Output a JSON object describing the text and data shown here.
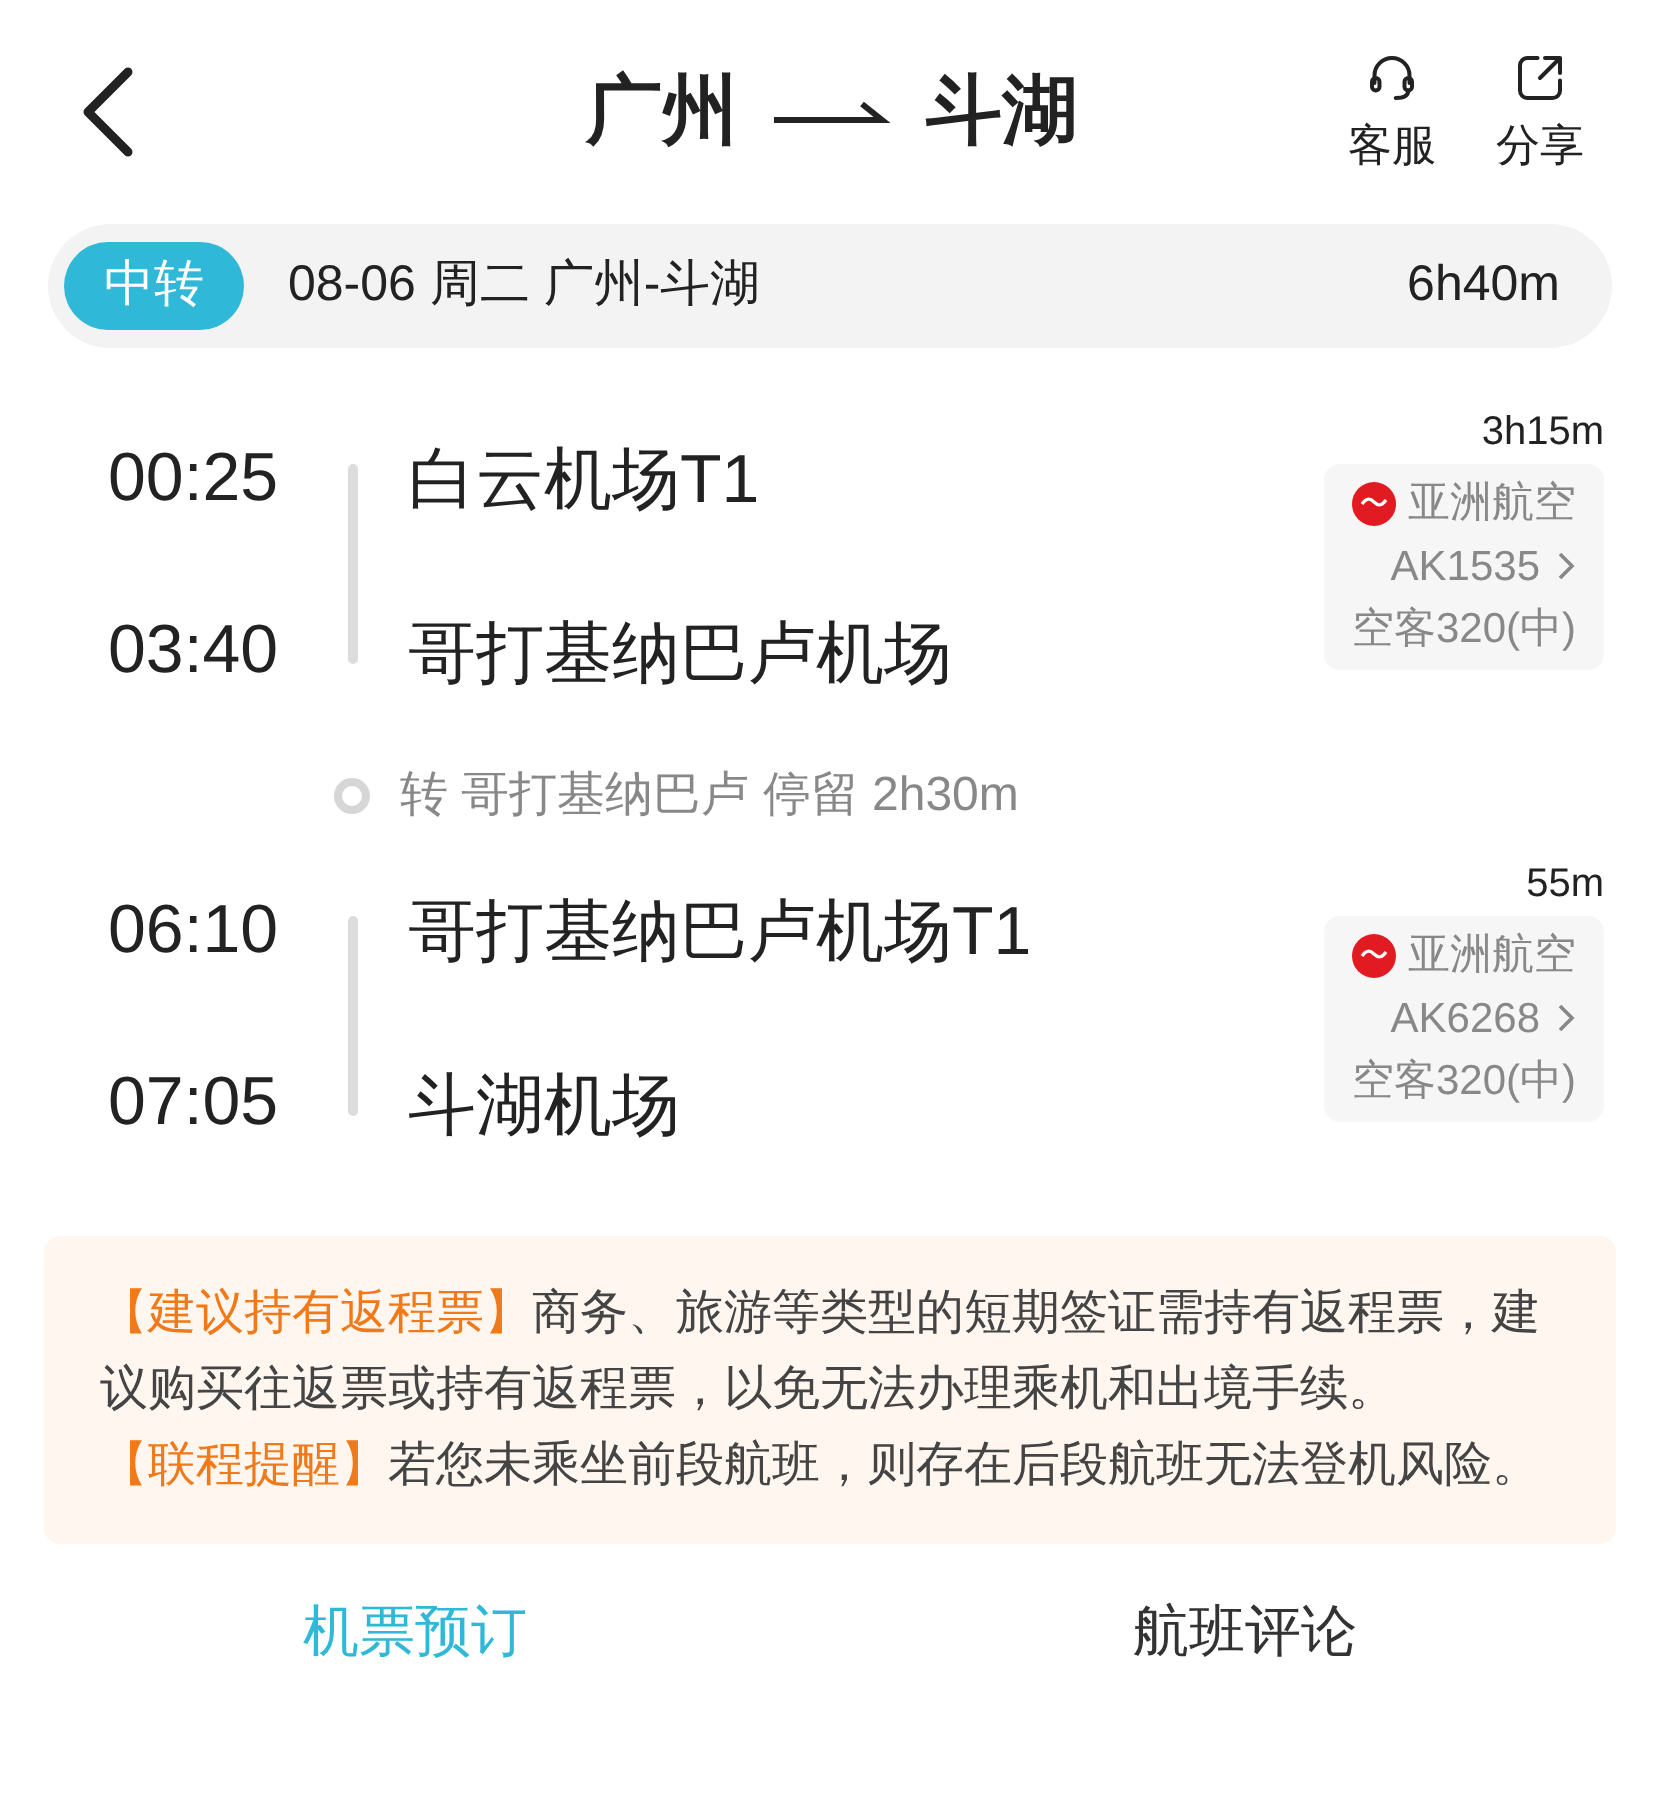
{
  "header": {
    "from": "广州",
    "to": "斗湖",
    "actions": [
      {
        "kind": "service",
        "label": "客服"
      },
      {
        "kind": "share",
        "label": "分享"
      }
    ]
  },
  "summary": {
    "badge": "中转",
    "text": "08-06 周二 广州-斗湖",
    "duration": "6h40m"
  },
  "segments": [
    {
      "dep_time": "00:25",
      "dep_airport": "白云机场T1",
      "arr_time": "03:40",
      "arr_airport": "哥打基纳巴卢机场",
      "duration": "3h15m",
      "airline": "亚洲航空",
      "flight": "AK1535",
      "aircraft": "空客320(中)"
    },
    {
      "dep_time": "06:10",
      "dep_airport": "哥打基纳巴卢机场T1",
      "arr_time": "07:05",
      "arr_airport": "斗湖机场",
      "duration": "55m",
      "airline": "亚洲航空",
      "flight": "AK6268",
      "aircraft": "空客320(中)"
    }
  ],
  "layover": "转 哥打基纳巴卢 停留 2h30m",
  "notices": [
    {
      "tag": "【建议持有返程票】",
      "text": "商务、旅游等类型的短期签证需持有返程票，建议购买往返票或持有返程票，以免无法办理乘机和出境手续。"
    },
    {
      "tag": "【联程提醒】",
      "text": "若您未乘坐前段航班，则存在后段航班无法登机风险。"
    }
  ],
  "tabs": [
    {
      "label": "机票预订",
      "selected": true
    },
    {
      "label": "航班评论",
      "selected": false
    }
  ]
}
